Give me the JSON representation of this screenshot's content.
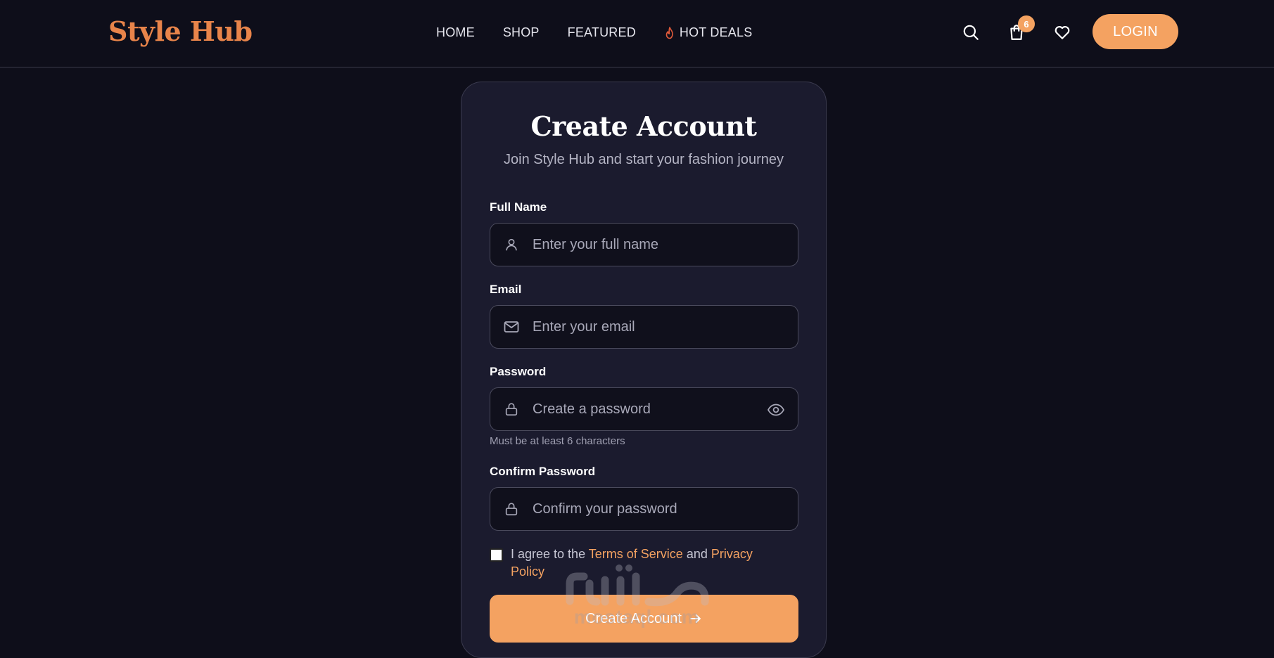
{
  "header": {
    "logo": "Style Hub",
    "nav": [
      "HOME",
      "SHOP",
      "FEATURED"
    ],
    "hot_deals": "HOT DEALS",
    "cart_count": "6",
    "login": "LOGIN"
  },
  "form": {
    "title": "Create Account",
    "subtitle": "Join Style Hub and start your fashion journey",
    "full_name": {
      "label": "Full Name",
      "placeholder": "Enter your full name"
    },
    "email": {
      "label": "Email",
      "placeholder": "Enter your email"
    },
    "password": {
      "label": "Password",
      "placeholder": "Create a password",
      "hint": "Must be at least 6 characters"
    },
    "confirm": {
      "label": "Confirm Password",
      "placeholder": "Confirm your password"
    },
    "agree": {
      "prefix": "I agree to the",
      "terms": "Terms of Service",
      "and": "and",
      "privacy": "Privacy Policy"
    },
    "submit": "Create Account"
  },
  "watermark": "mostaql.com",
  "colors": {
    "accent": "#f4a261",
    "logo": "#e8844a",
    "background": "#0e0e1a",
    "card": "#1b1b2e"
  },
  "icons": [
    "search-icon",
    "cart-icon",
    "heart-icon",
    "user-icon",
    "mail-icon",
    "lock-icon",
    "eye-icon",
    "flame-icon",
    "arrow-right-icon"
  ]
}
